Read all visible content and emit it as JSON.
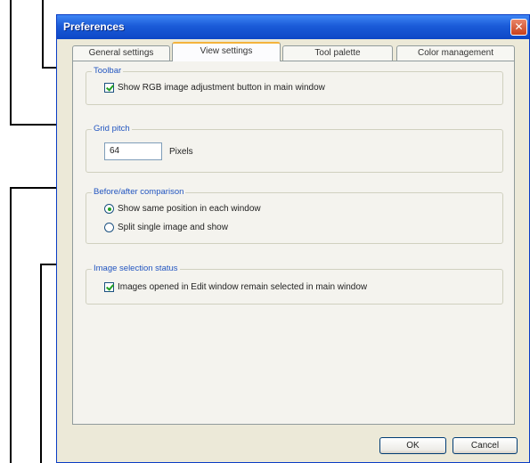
{
  "window": {
    "title": "Preferences",
    "close_glyph": "✕"
  },
  "tabs": [
    {
      "label": "General settings",
      "active": false
    },
    {
      "label": "View settings",
      "active": true
    },
    {
      "label": "Tool palette",
      "active": false
    },
    {
      "label": "Color management",
      "active": false
    }
  ],
  "groups": {
    "toolbar": {
      "title": "Toolbar",
      "checkbox_label": "Show RGB image adjustment button in main window",
      "checked": true
    },
    "grid_pitch": {
      "title": "Grid pitch",
      "value": "64",
      "unit": "Pixels"
    },
    "comparison": {
      "title": "Before/after comparison",
      "options": [
        {
          "label": "Show same position in each window",
          "selected": true
        },
        {
          "label": "Split single image and show",
          "selected": false
        }
      ]
    },
    "selection_status": {
      "title": "Image selection status",
      "checkbox_label": "Images opened in Edit window remain selected in main window",
      "checked": true
    }
  },
  "buttons": {
    "ok": "OK",
    "cancel": "Cancel"
  },
  "colors": {
    "titlebar": "#1a5bd8",
    "group_title": "#2255c0",
    "check_mark": "#21a121",
    "active_tab_accent": "#f4b33c"
  }
}
